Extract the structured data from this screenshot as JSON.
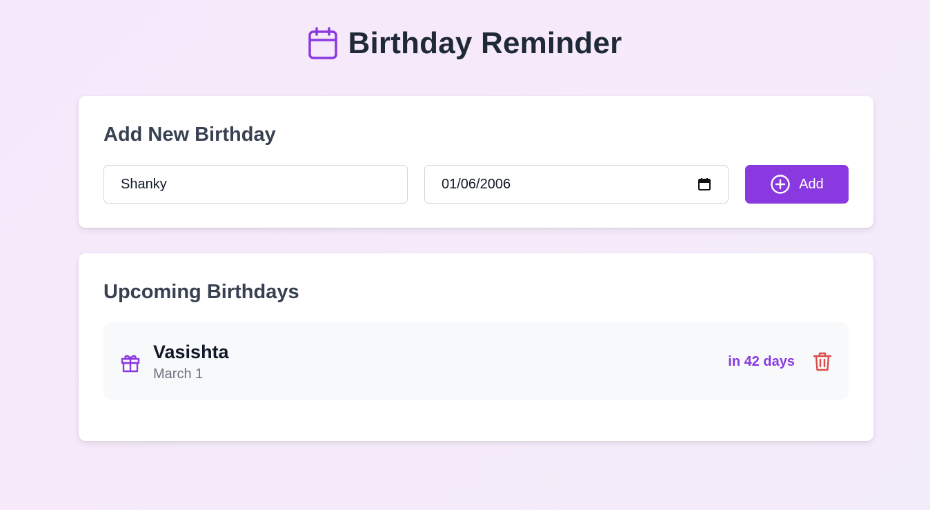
{
  "header": {
    "title": "Birthday Reminder",
    "icon": "calendar-icon",
    "accent": "#8a39e0"
  },
  "add_form": {
    "heading": "Add New Birthday",
    "name_value": "Shanky",
    "date_value": "01/06/2006",
    "add_label": "Add"
  },
  "list": {
    "heading": "Upcoming Birthdays",
    "items": [
      {
        "name": "Vasishta",
        "date": "March 1",
        "countdown": "in 42 days",
        "icon": "gift-icon"
      }
    ]
  },
  "colors": {
    "accent": "#8a39e0",
    "danger": "#dc4b4b"
  }
}
